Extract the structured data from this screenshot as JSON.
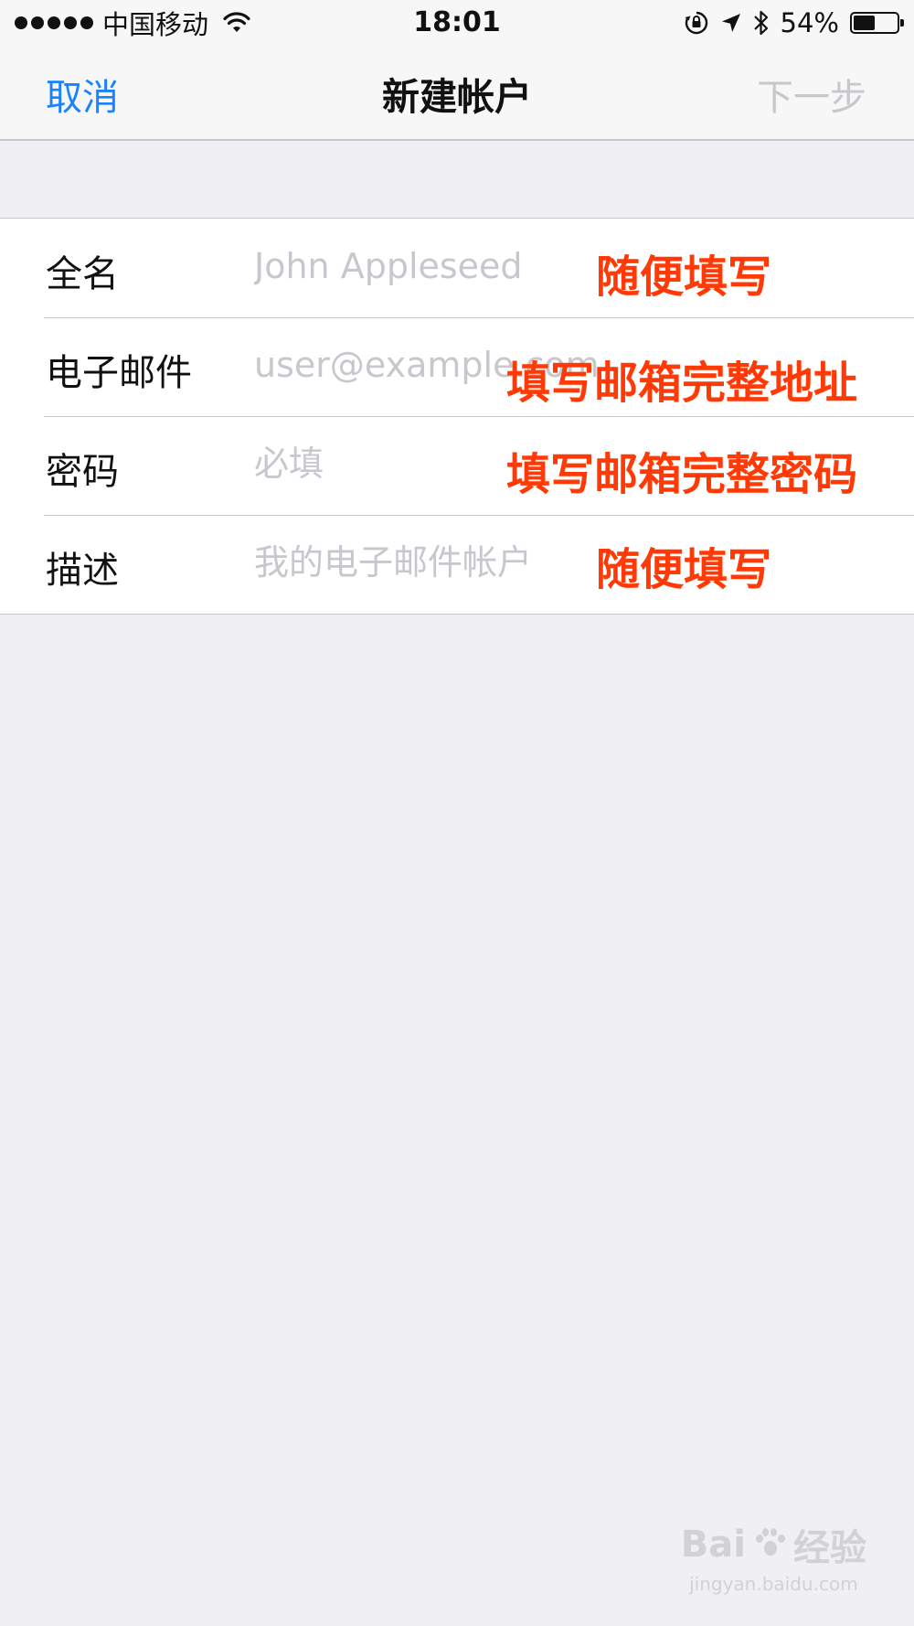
{
  "status_bar": {
    "carrier": "中国移动",
    "time": "18:01",
    "battery_percent": "54%",
    "battery_level": 0.54,
    "icons": [
      "signal-dots-icon",
      "wifi-icon",
      "orientation-lock-icon",
      "location-arrow-icon",
      "bluetooth-icon",
      "battery-icon"
    ]
  },
  "nav": {
    "cancel_label": "取消",
    "title": "新建帐户",
    "next_label": "下一步",
    "accent_color": "#1a82fb",
    "disabled_color": "#c7c7cc"
  },
  "form": {
    "rows": [
      {
        "label": "全名",
        "placeholder": "John Appleseed",
        "annotation": "随便填写"
      },
      {
        "label": "电子邮件",
        "placeholder": "user@example.com",
        "annotation": "填写邮箱完整地址"
      },
      {
        "label": "密码",
        "placeholder": "必填",
        "annotation": "填写邮箱完整密码"
      },
      {
        "label": "描述",
        "placeholder": "我的电子邮件帐户",
        "annotation": "随便填写"
      }
    ],
    "annotation_color": "#ff3a06"
  },
  "watermark": {
    "logo_text_left": "Bai",
    "logo_text_right": "经验",
    "url": "jingyan.baidu.com"
  }
}
